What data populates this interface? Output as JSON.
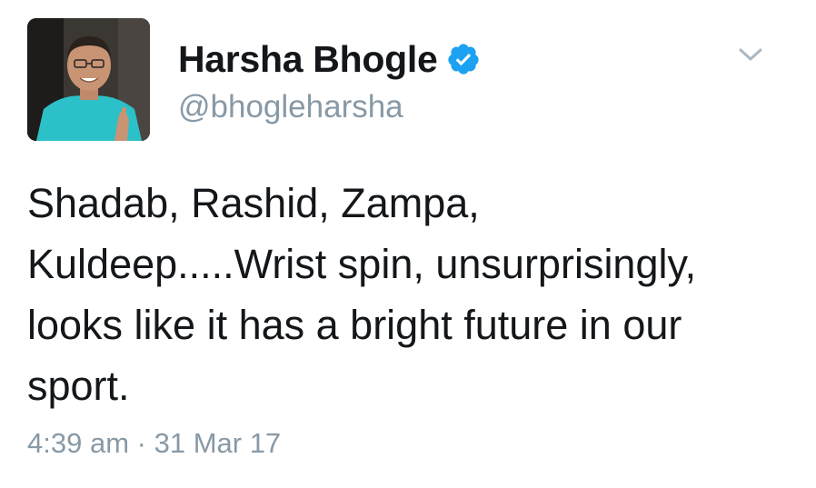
{
  "author": {
    "display_name": "Harsha Bhogle",
    "handle": "@bhogleharsha",
    "verified": true
  },
  "tweet": {
    "lines": [
      "Shadab, Rashid, Zampa,",
      "Kuldeep.....Wrist spin, unsurprisingly,",
      "looks like it has a bright future in our",
      "sport."
    ],
    "time": "4:39 am",
    "separator": "·",
    "date": "31 Mar 17"
  },
  "icons": {
    "verified": "verified-badge-icon",
    "menu": "chevron-down-icon"
  },
  "colors": {
    "name_text": "#14171a",
    "secondary_text": "#8899a6",
    "verified_blue": "#1da1f2",
    "background": "#ffffff"
  }
}
